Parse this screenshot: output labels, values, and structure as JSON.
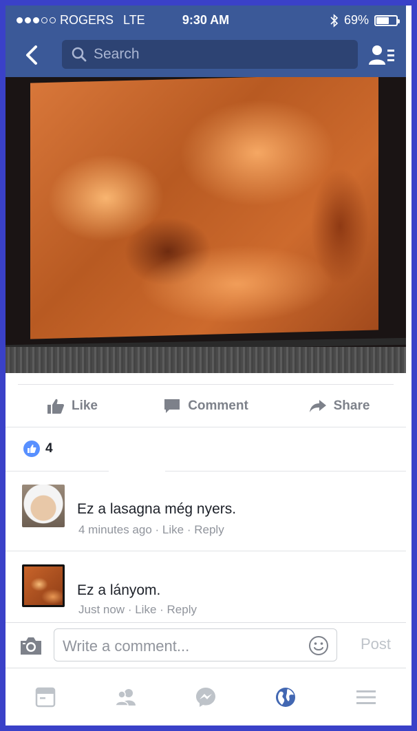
{
  "status_bar": {
    "carrier": "ROGERS",
    "network": "LTE",
    "time": "9:30 AM",
    "battery": "69%",
    "battery_level": 0.69,
    "signal_bars_filled": 3,
    "signal_bars_total": 5
  },
  "nav": {
    "search_placeholder": "Search"
  },
  "post": {
    "actions": {
      "like": "Like",
      "comment": "Comment",
      "share": "Share"
    },
    "like_count": "4"
  },
  "comments": [
    {
      "text": "Ez a lasagna még nyers.",
      "time": "4 minutes ago",
      "like": "Like",
      "reply": "Reply"
    },
    {
      "text": "Ez a lányom.",
      "time": "Just now",
      "like": "Like",
      "reply": "Reply"
    }
  ],
  "composer": {
    "placeholder": "Write a comment...",
    "post_label": "Post"
  },
  "tabbar": {
    "icons": [
      "news-feed-icon",
      "friends-icon",
      "messenger-icon",
      "notifications-globe-icon",
      "menu-icon"
    ]
  },
  "colors": {
    "facebook_blue": "#3b5998",
    "search_bg": "#2d4373",
    "frame_border": "#3a41c8",
    "like_badge": "#5890ff",
    "globe_blue": "#4267b2"
  }
}
